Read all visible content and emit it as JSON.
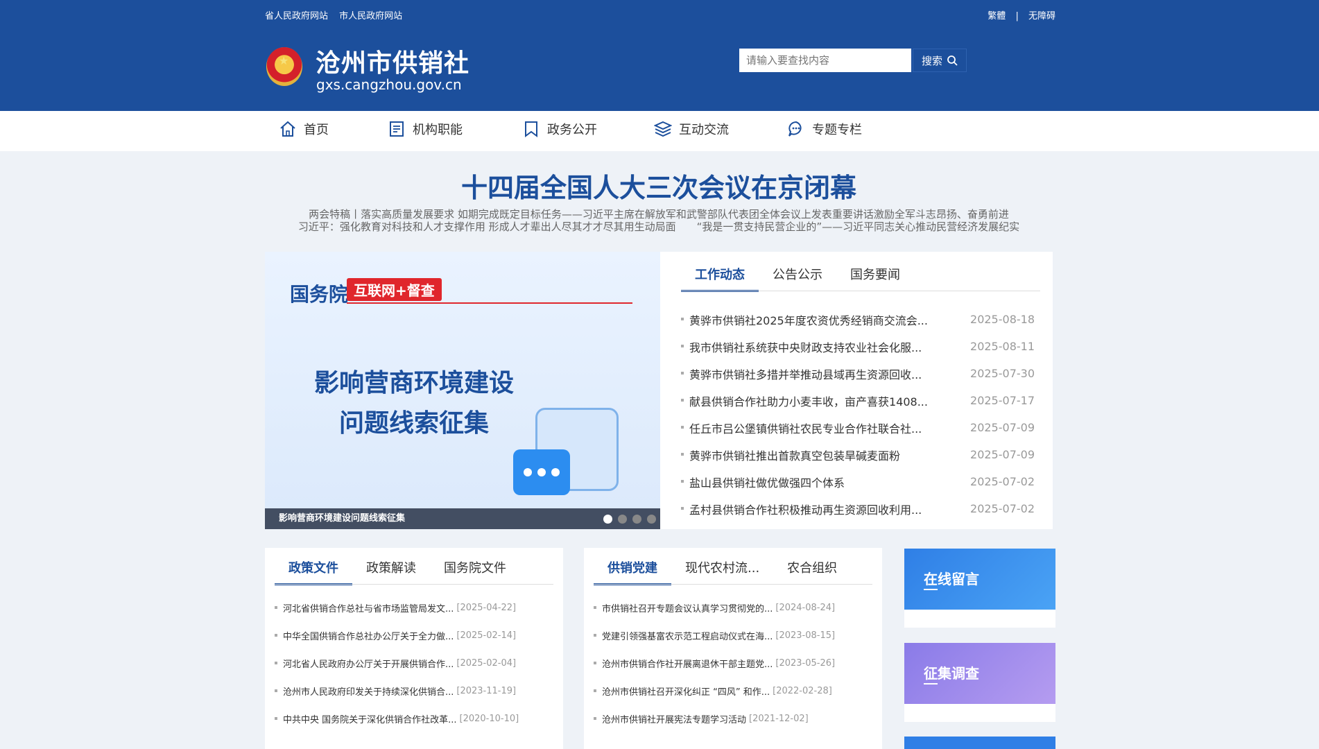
{
  "top_links": [
    "省人民政府网站",
    "市人民政府网站"
  ],
  "top_right": {
    "traditional": "繁體",
    "separator": "|",
    "accessibility": "无障碍"
  },
  "site": {
    "title": "沧州市供销社",
    "domain": "gxs.cangzhou.gov.cn"
  },
  "search": {
    "placeholder": "请输入要查找内容",
    "button": "搜索"
  },
  "nav": [
    {
      "label": "首页",
      "icon": "home-icon"
    },
    {
      "label": "机构职能",
      "icon": "document-icon"
    },
    {
      "label": "政务公开",
      "icon": "bookmark-icon"
    },
    {
      "label": "互动交流",
      "icon": "layers-icon"
    },
    {
      "label": "专题专栏",
      "icon": "chat-icon"
    }
  ],
  "headline": {
    "title": "十四届全国人大三次会议在京闭幕",
    "sub1": "两会特稿丨落实高质量发展要求 如期完成既定目标任务——习近平主席在解放军和武警部队代表团全体会议上发表重要讲话激励全军斗志昂扬、奋勇前进",
    "sub2": "习近平：强化教育对科技和人才支撑作用 形成人才辈出人尽其才才尽其用生动局面　　“我是一贯支持民营企业的”——习近平同志关心推动民营经济发展纪实"
  },
  "banner": {
    "gov": "国务院",
    "tag": "互联网+督查",
    "line1": "影响营商环境建设",
    "line2": "问题线索征集",
    "caption": "影响营商环境建设问题线索征集",
    "slide_count": 4,
    "active_slide": 1
  },
  "news": {
    "tabs": [
      "工作动态",
      "公告公示",
      "国务要闻"
    ],
    "items": [
      {
        "title": "黄骅市供销社2025年度农资优秀经销商交流会...",
        "date": "2025-08-18"
      },
      {
        "title": "我市供销社系统获中央财政支持农业社会化服...",
        "date": "2025-08-11"
      },
      {
        "title": "黄骅市供销社多措并举推动县域再生资源回收...",
        "date": "2025-07-30"
      },
      {
        "title": "献县供销合作社助力小麦丰收，亩产喜获1408...",
        "date": "2025-07-17"
      },
      {
        "title": "任丘市吕公堡镇供销社农民专业合作社联合社...",
        "date": "2025-07-09"
      },
      {
        "title": "黄骅市供销社推出首款真空包装旱碱麦面粉",
        "date": "2025-07-09"
      },
      {
        "title": "盐山县供销社做优做强四个体系",
        "date": "2025-07-02"
      },
      {
        "title": "孟村县供销合作社积极推动再生资源回收利用...",
        "date": "2025-07-02"
      }
    ]
  },
  "policy": {
    "tabs": [
      "政策文件",
      "政策解读",
      "国务院文件"
    ],
    "items": [
      {
        "title": "河北省供销合作总社与省市场监管局发文...",
        "date": "[2025-04-22]"
      },
      {
        "title": "中华全国供销合作总社办公厅关于全力做...",
        "date": "[2025-02-14]"
      },
      {
        "title": "河北省人民政府办公厅关于开展供销合作...",
        "date": "[2025-02-04]"
      },
      {
        "title": "沧州市人民政府印发关于持续深化供销合...",
        "date": "[2023-11-19]"
      },
      {
        "title": "中共中央 国务院关于深化供销合作社改革...",
        "date": "[2020-10-10]"
      }
    ]
  },
  "party": {
    "tabs": [
      "供销党建",
      "现代农村流...",
      "农合组织"
    ],
    "items": [
      {
        "title": "市供销社召开专题会议认真学习贯彻党的...",
        "date": "[2024-08-24]"
      },
      {
        "title": "党建引领强基富农示范工程启动仪式在海...",
        "date": "[2023-08-15]"
      },
      {
        "title": "沧州市供销合作社开展离退休干部主题党...",
        "date": "[2023-05-26]"
      },
      {
        "title": "沧州市供销社召开深化纠正 “四风” 和作...",
        "date": "[2022-02-28]"
      },
      {
        "title": "沧州市供销社开展宪法专题学习活动",
        "date": "[2021-12-02]"
      }
    ]
  },
  "side": [
    {
      "label": "在线留言",
      "color": "#2f7fe6"
    },
    {
      "label": "征集调查",
      "color": "#8a7be8"
    }
  ],
  "colors": {
    "brand": "#1c4f9c",
    "red": "#e0262c"
  }
}
